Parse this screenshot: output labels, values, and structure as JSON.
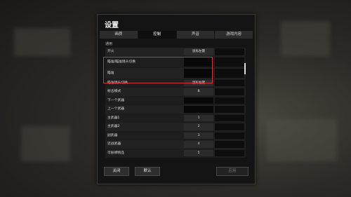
{
  "dialog": {
    "title": "设置"
  },
  "tabs": [
    {
      "label": "画质"
    },
    {
      "label": "控制"
    },
    {
      "label": "声音"
    },
    {
      "label": "游戏内容"
    }
  ],
  "section_title": "通用",
  "rows": [
    {
      "label": "开火",
      "key1": "鼠标左键",
      "key2": ""
    },
    {
      "label": "瞄准/瞄准镜头切换",
      "key1": "",
      "key2": ""
    },
    {
      "label": "瞄准",
      "key1": "",
      "key2": ""
    },
    {
      "label": "瞄准镜头切换",
      "key1": "鼠标右键",
      "key2": ""
    },
    {
      "label": "射击模式",
      "key1": "B",
      "key2": ""
    },
    {
      "label": "下一个武器",
      "key1": "",
      "key2": ""
    },
    {
      "label": "上一个武器",
      "key1": "",
      "key2": ""
    },
    {
      "label": "主武器1",
      "key1": "1",
      "key2": ""
    },
    {
      "label": "主武器2",
      "key1": "2",
      "key2": ""
    },
    {
      "label": "副武器",
      "key1": "3",
      "key2": ""
    },
    {
      "label": "近战武器",
      "key1": "4",
      "key2": ""
    },
    {
      "label": "可投掷物品",
      "key1": "5",
      "key2": ""
    }
  ],
  "buttons": {
    "close": "关闭",
    "default": "默认",
    "apply": "应用"
  }
}
